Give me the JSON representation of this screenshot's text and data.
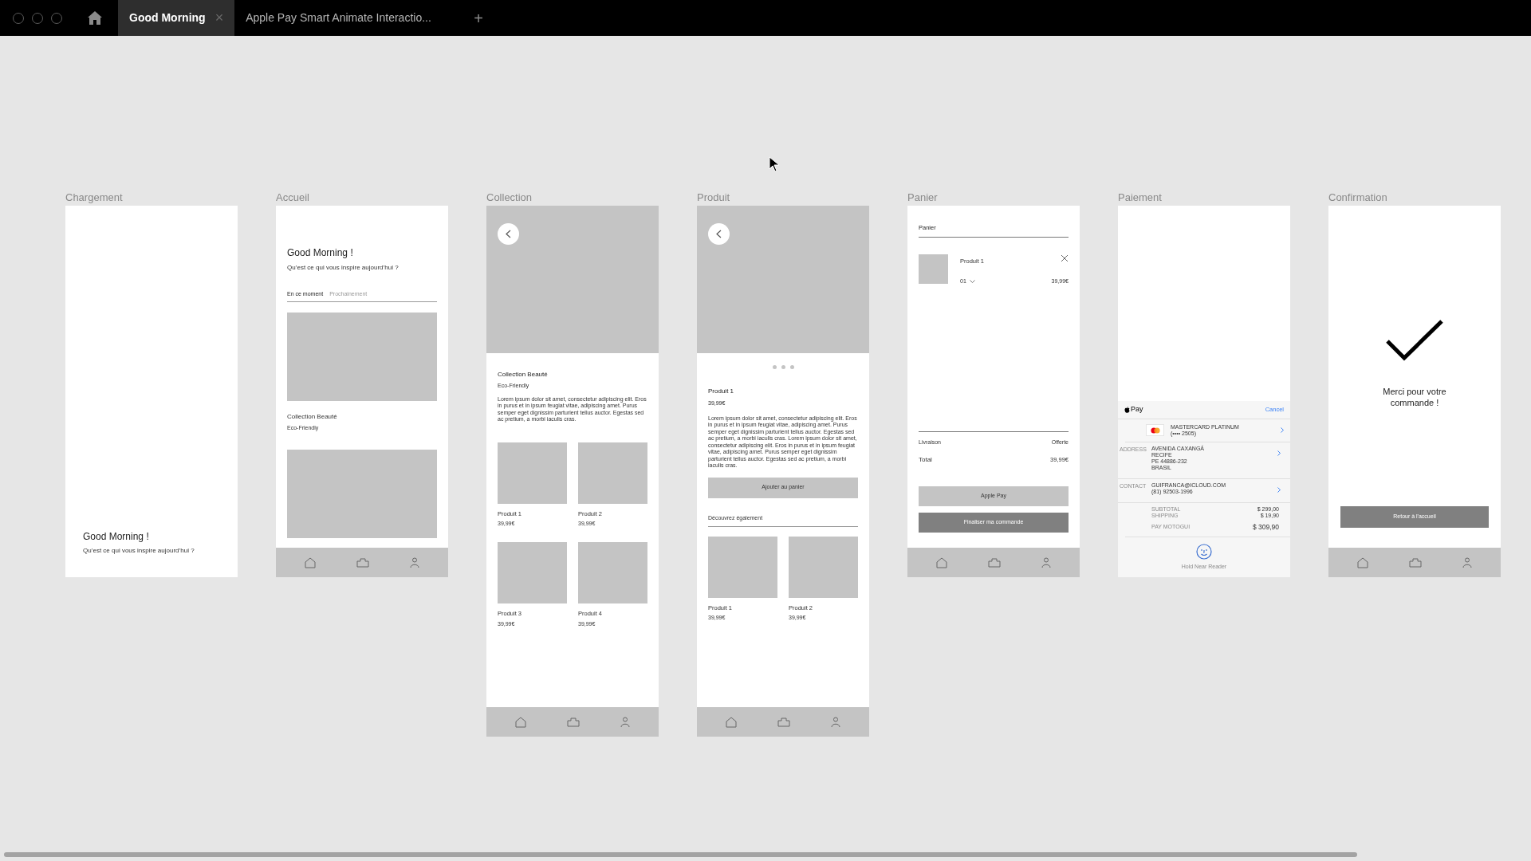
{
  "tabs": [
    {
      "label": "Good Morning",
      "selected": true,
      "close": "×"
    },
    {
      "label": "Apple Pay Smart Animate Interactio...",
      "selected": false
    }
  ],
  "new_tab": "+",
  "artboards": [
    {
      "kind": "loading",
      "title": "Chargement",
      "heading": "Good Morning !",
      "subheading": "Qu’est ce qui vous inspire aujourd’hui ?"
    },
    {
      "kind": "home",
      "title": "Accueil",
      "heading": "Good Morning !",
      "subheading": "Qu’est ce qui vous inspire aujourd’hui ?",
      "tabs": [
        {
          "label": "En ce moment",
          "selected": true
        },
        {
          "label": "Prochainement",
          "selected": false
        }
      ],
      "card_title": "Collection Beauté",
      "card_tag": "Eco-Friendly"
    },
    {
      "kind": "collection",
      "title": "Collection",
      "heading": "Collection Beauté",
      "tag": "Eco-Friendly",
      "description": "Lorem ipsum dolor sit amet, consectetur adipiscing elit. Eros in purus et in ipsum feugiat vitae, adipiscing amet. Purus semper eget dignissim parturient tellus auctor. Egestas sed ac pretium, a morbi iaculis cras.",
      "products": [
        {
          "name": "Produit 1",
          "price": "39,99€"
        },
        {
          "name": "Produit 2",
          "price": "39,99€"
        },
        {
          "name": "Produit 3",
          "price": "39,99€"
        },
        {
          "name": "Produit 4",
          "price": "39,99€"
        }
      ]
    },
    {
      "kind": "product",
      "title": "Produit",
      "heading": "Produit 1",
      "price": "39,99€",
      "description": "Lorem ipsum dolor sit amet, consectetur adipiscing elit. Eros in purus et in ipsum feugiat vitae, adipiscing amet. Purus semper eget dignissim parturient tellus auctor. Egestas sed ac pretium, a morbi iaculis cras. Lorem ipsum dolor sit amet, consectetur adipiscing elit. Eros in purus et in ipsum feugiat vitae, adipiscing amet. Purus semper eget dignissim parturient tellus auctor. Egestas sed ac pretium, a morbi iaculis cras.",
      "button": "Ajouter au panier",
      "section": "Découvrez également",
      "products": [
        {
          "name": "Produit 1",
          "price": "39,99€"
        },
        {
          "name": "Produit 2",
          "price": "39,99€"
        }
      ]
    },
    {
      "kind": "cart",
      "title": "Panier",
      "heading": "Panier",
      "item": {
        "name": "Produit 1",
        "quantity": "01",
        "price": "39,99€"
      },
      "delivery": {
        "label": "Livraison",
        "value": "Offerte"
      },
      "total": {
        "label": "Total",
        "value": "39,99€"
      },
      "buttons": [
        {
          "label": "Apple Pay",
          "kind": "secondary"
        },
        {
          "label": "Finaliser ma commande",
          "kind": "primary"
        }
      ]
    },
    {
      "kind": "payment",
      "title": "Paiement",
      "brand": "Pay",
      "cancel": "Cancel",
      "card": [
        "MASTERCARD PLATINUM",
        "(•••• 2505)"
      ],
      "address": {
        "label": "ADDRESS",
        "lines": [
          "AVENIDA CAXANGÁ",
          "RECIFE",
          "PE 44886-232",
          "BRASIL"
        ]
      },
      "contact": {
        "label": "CONTACT",
        "lines": [
          "GUIFRANCA@ICLOUD.COM",
          "(81) 92503-1996"
        ]
      },
      "subtotal": {
        "label": "SUBTOTAL",
        "value": "$ 299,00"
      },
      "shipping": {
        "label": "SHIPPING",
        "value": "$ 19,90"
      },
      "pay": {
        "label": "PAY MOTOGUI",
        "value": "$ 309,90"
      },
      "hint": "Hold Near Reader"
    },
    {
      "kind": "confirmation",
      "title": "Confirmation",
      "message": "Merci pour votre commande !",
      "button": "Retour à l'accueil"
    }
  ]
}
